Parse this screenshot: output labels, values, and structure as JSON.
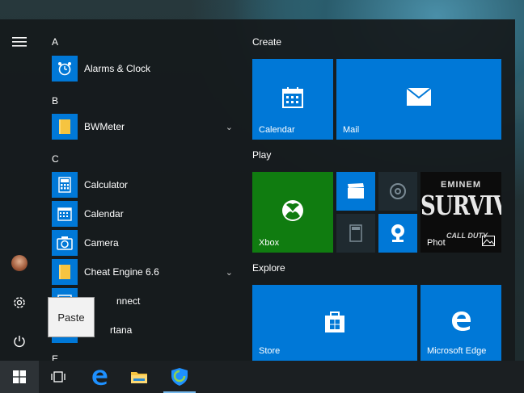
{
  "app_list": {
    "letters": [
      "A",
      "B",
      "C",
      "E"
    ],
    "apps": [
      {
        "label": "Alarms & Clock",
        "icon": "alarm-clock-icon",
        "expandable": false
      },
      {
        "label": "BWMeter",
        "icon": "folder-icon",
        "expandable": true
      },
      {
        "label": "Calculator",
        "icon": "calculator-icon",
        "expandable": false
      },
      {
        "label": "Calendar",
        "icon": "calendar-icon",
        "expandable": false
      },
      {
        "label": "Camera",
        "icon": "camera-icon",
        "expandable": false
      },
      {
        "label": "Cheat Engine 6.6",
        "icon": "folder-icon",
        "expandable": true
      },
      {
        "label": "nnect",
        "icon": "connect-icon",
        "expandable": false
      },
      {
        "label": "rtana",
        "icon": "cortana-icon",
        "expandable": false
      }
    ]
  },
  "tooltip": {
    "text": "Paste"
  },
  "tiles": {
    "groups": [
      {
        "title": "Create",
        "tiles": [
          {
            "label": "Calendar"
          },
          {
            "label": "Mail"
          }
        ]
      },
      {
        "title": "Play",
        "tiles": [
          {
            "label": "Xbox"
          },
          {
            "label": "Phot"
          },
          {
            "label": "EMINEM"
          },
          {
            "label": "SURVIVAL"
          },
          {
            "label": "CALL DUTY"
          }
        ]
      },
      {
        "title": "Explore",
        "tiles": [
          {
            "label": "Store"
          },
          {
            "label": "Microsoft Edge"
          }
        ]
      }
    ]
  },
  "colors": {
    "accent": "#0078d7",
    "xbox": "#107c10",
    "menu_bg": "#161a1c",
    "taskbar": "#1b1f22"
  }
}
